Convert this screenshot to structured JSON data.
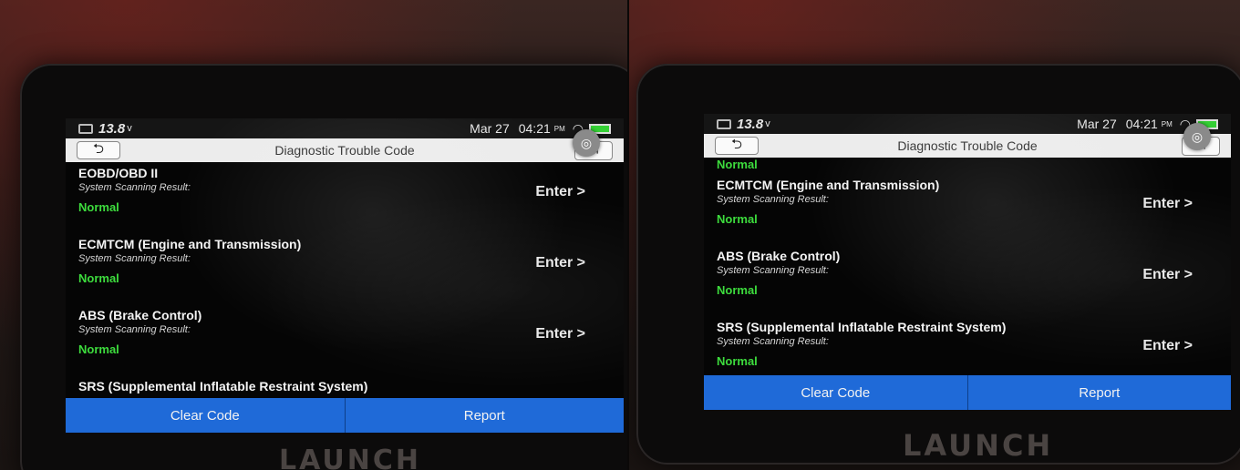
{
  "status": {
    "voltage": "13.8",
    "voltage_unit": "v",
    "date": "Mar 27",
    "time": "04:21",
    "ampm": "PM"
  },
  "header": {
    "title": "Diagnostic Trouble Code",
    "back_glyph": "⮌",
    "exit_glyph": "⇥"
  },
  "camera_glyph": "◎",
  "wifi_glyph": "◠",
  "left_list": [
    {
      "name": "EOBD/OBD II",
      "sub": "System Scanning Result:",
      "status": "Normal",
      "enter": "Enter >"
    },
    {
      "name": "ECMTCM (Engine and Transmission)",
      "sub": "System Scanning Result:",
      "status": "Normal",
      "enter": "Enter >"
    },
    {
      "name": "ABS (Brake Control)",
      "sub": "System Scanning Result:",
      "status": "Normal",
      "enter": "Enter >"
    },
    {
      "name": "SRS (Supplemental Inflatable Restraint System)"
    }
  ],
  "right_top_status": "Normal",
  "right_list": [
    {
      "name": "ECMTCM (Engine and Transmission)",
      "sub": "System Scanning Result:",
      "status": "Normal",
      "enter": "Enter >"
    },
    {
      "name": "ABS (Brake Control)",
      "sub": "System Scanning Result:",
      "status": "Normal",
      "enter": "Enter >"
    },
    {
      "name": "SRS (Supplemental Inflatable Restraint System)",
      "sub": "System Scanning Result:",
      "status": "Normal",
      "enter": "Enter >"
    }
  ],
  "actions": {
    "clear": "Clear Code",
    "report": "Report"
  },
  "brand": "LAUNCH",
  "colors": {
    "accent": "#1f6ad8",
    "status_ok": "#3ddc3d"
  }
}
